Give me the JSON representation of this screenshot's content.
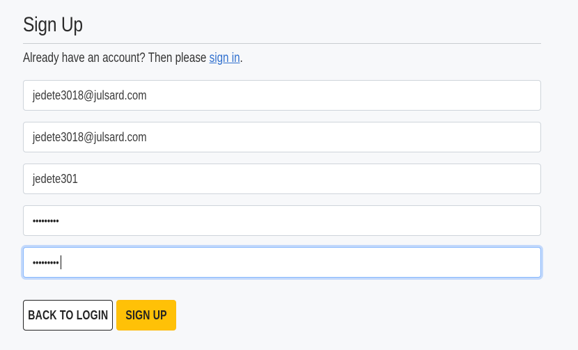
{
  "page": {
    "title": "Sign Up",
    "subtitle_prefix": "Already have an account? Then please ",
    "subtitle_link": "sign in",
    "subtitle_suffix": "."
  },
  "form": {
    "email": "jedete3018@julsard.com",
    "email_confirm": "jedete3018@julsard.com",
    "username": "jedete301",
    "password": "•••••••••",
    "password_confirm": "•••••••••"
  },
  "buttons": {
    "back_to_login": "Back to Login",
    "sign_up": "Sign Up"
  },
  "colors": {
    "primary_button": "#ffc107",
    "link": "#2f6fce",
    "focus_ring": "#86b7fe"
  }
}
